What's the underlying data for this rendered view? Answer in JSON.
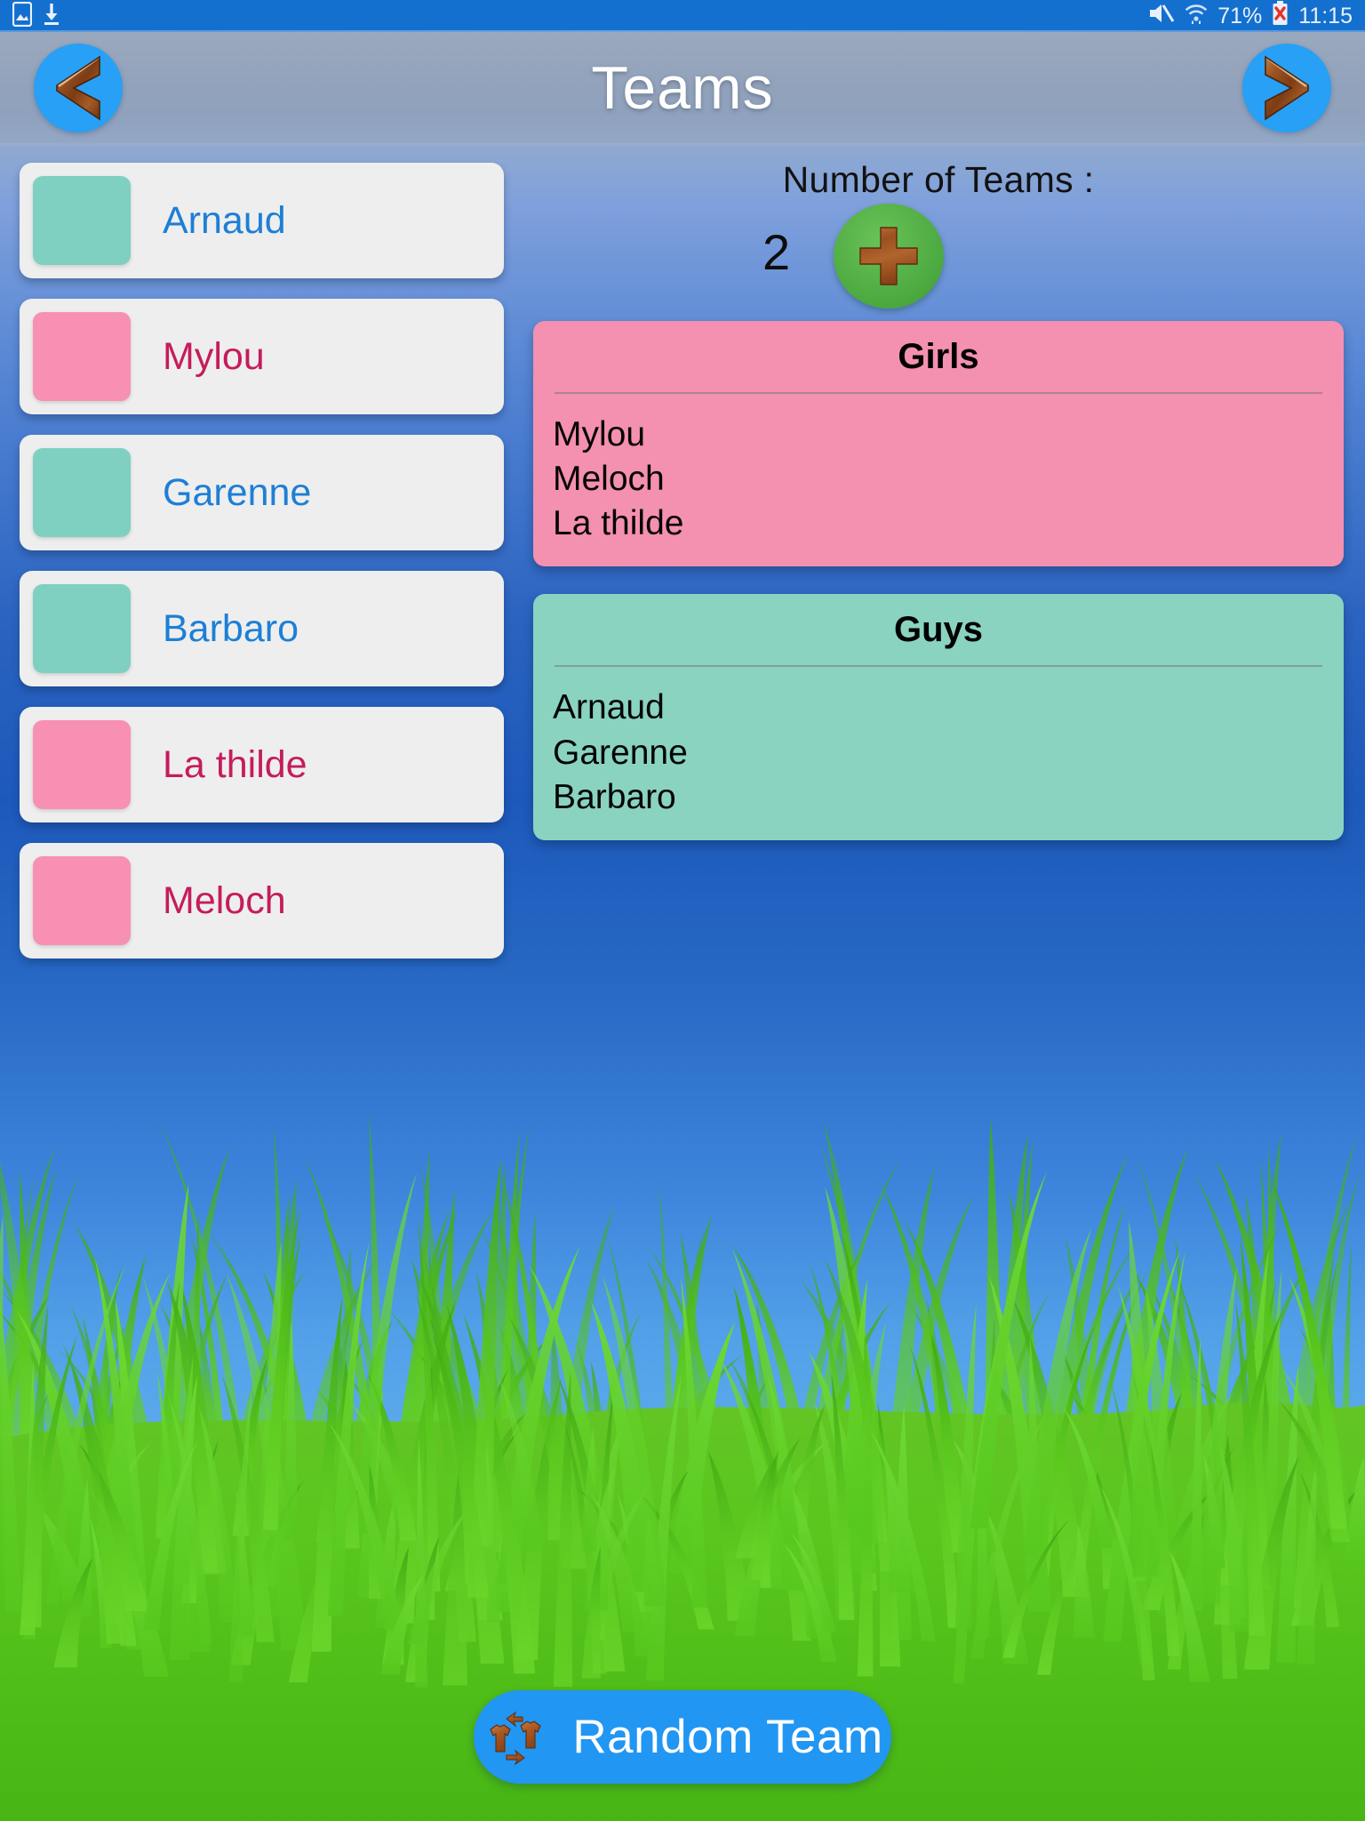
{
  "status_bar": {
    "left_icons": [
      "screenshot-image-icon",
      "download-icon"
    ],
    "right_icons": [
      "mute-icon",
      "wifi-icon",
      "battery-error-icon"
    ],
    "battery_percent": "71%",
    "time": "11:15"
  },
  "header": {
    "title": "Teams",
    "prev_label": "",
    "next_label": "",
    "prev_icon": "chevron-left-icon",
    "next_icon": "chevron-right-icon"
  },
  "players": [
    {
      "name": "Arnaud",
      "gender": "m",
      "swatch": "#7fd0c0"
    },
    {
      "name": "Mylou",
      "gender": "f",
      "swatch": "#f790b2"
    },
    {
      "name": "Garenne",
      "gender": "m",
      "swatch": "#7fd0c0"
    },
    {
      "name": "Barbaro",
      "gender": "m",
      "swatch": "#7fd0c0"
    },
    {
      "name": "La thilde",
      "gender": "f",
      "swatch": "#f790b2"
    },
    {
      "name": "Meloch",
      "gender": "f",
      "swatch": "#f790b2"
    }
  ],
  "teams_panel": {
    "count_label": "Number of Teams :",
    "count_value": "2",
    "add_button_icon": "plus-icon",
    "teams": [
      {
        "title": "Girls",
        "color": "#f490b0",
        "members": [
          "Mylou",
          "Meloch",
          "La thilde"
        ]
      },
      {
        "title": "Guys",
        "color": "#8ad3c1",
        "members": [
          "Arnaud",
          "Garenne",
          "Barbaro"
        ]
      }
    ]
  },
  "bottom_bar": {
    "random_team_label": "Random Team",
    "random_team_icon": "shuffle-shirts-icon"
  },
  "colors": {
    "accent_blue": "#2196f3",
    "male_text": "#1d7fd6",
    "female_text": "#c51c5c",
    "add_green": "#4aa83f",
    "wood_brown": "#a9561f"
  }
}
